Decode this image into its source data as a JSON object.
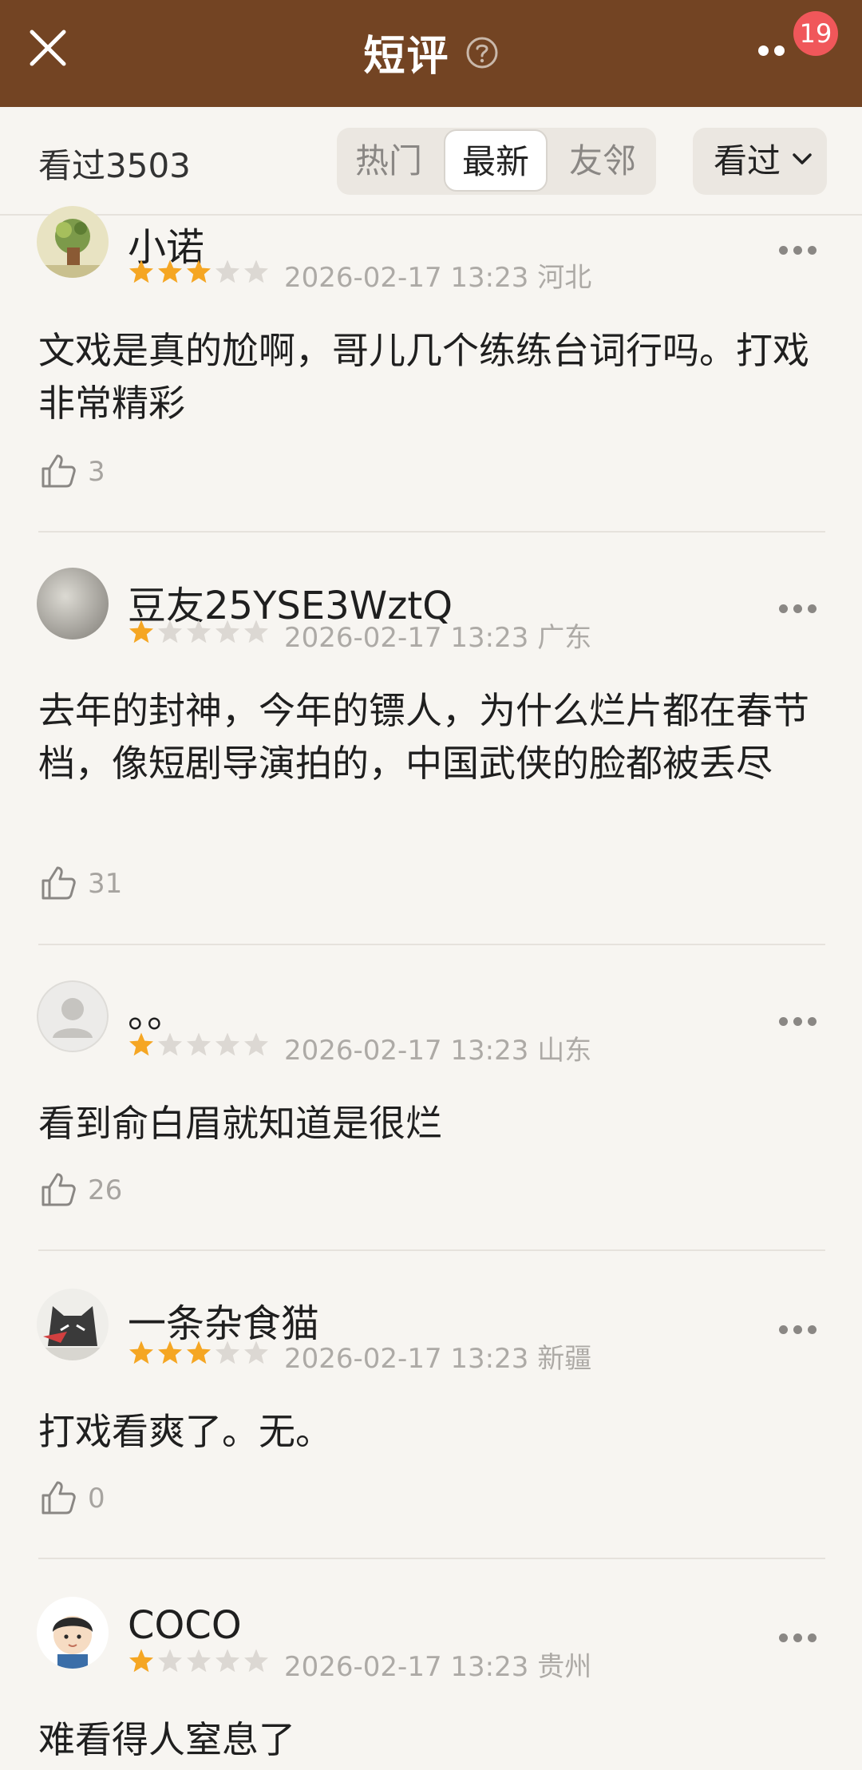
{
  "header": {
    "title": "短评",
    "badge_count": "19",
    "background_color": "#734423"
  },
  "filter_bar": {
    "watched_label": "看过3503",
    "tabs": [
      {
        "label": "热门",
        "active": false
      },
      {
        "label": "最新",
        "active": true
      },
      {
        "label": "友邻",
        "active": false
      }
    ],
    "status_dropdown": "看过"
  },
  "reviews": [
    {
      "username": "小诺",
      "rating": 3,
      "meta": "2026-02-17 13:23 河北",
      "content": "文戏是真的尬啊，哥儿几个练练台词行吗。打戏非常精彩",
      "likes": "3"
    },
    {
      "username": "豆友25YSE3WztQ",
      "rating": 1,
      "meta": "2026-02-17 13:23 广东",
      "content": "去年的封神，今年的镖人，为什么烂片都在春节档，像短剧导演拍的，中国武侠的脸都被丢尽",
      "likes": "31"
    },
    {
      "username": "。。",
      "rating": 1,
      "meta": "2026-02-17 13:23 山东",
      "content": "看到俞白眉就知道是很烂",
      "likes": "26"
    },
    {
      "username": "一条杂食猫",
      "rating": 3,
      "meta": "2026-02-17 13:23 新疆",
      "content": "打戏看爽了。无。",
      "likes": "0"
    },
    {
      "username": "COCO",
      "rating": 1,
      "meta": "2026-02-17 13:23 贵州",
      "content": "难看得人窒息了",
      "likes": ""
    }
  ],
  "colors": {
    "star_filled": "#f5a623",
    "star_empty": "#dcd8d3",
    "badge": "#f0575a"
  }
}
